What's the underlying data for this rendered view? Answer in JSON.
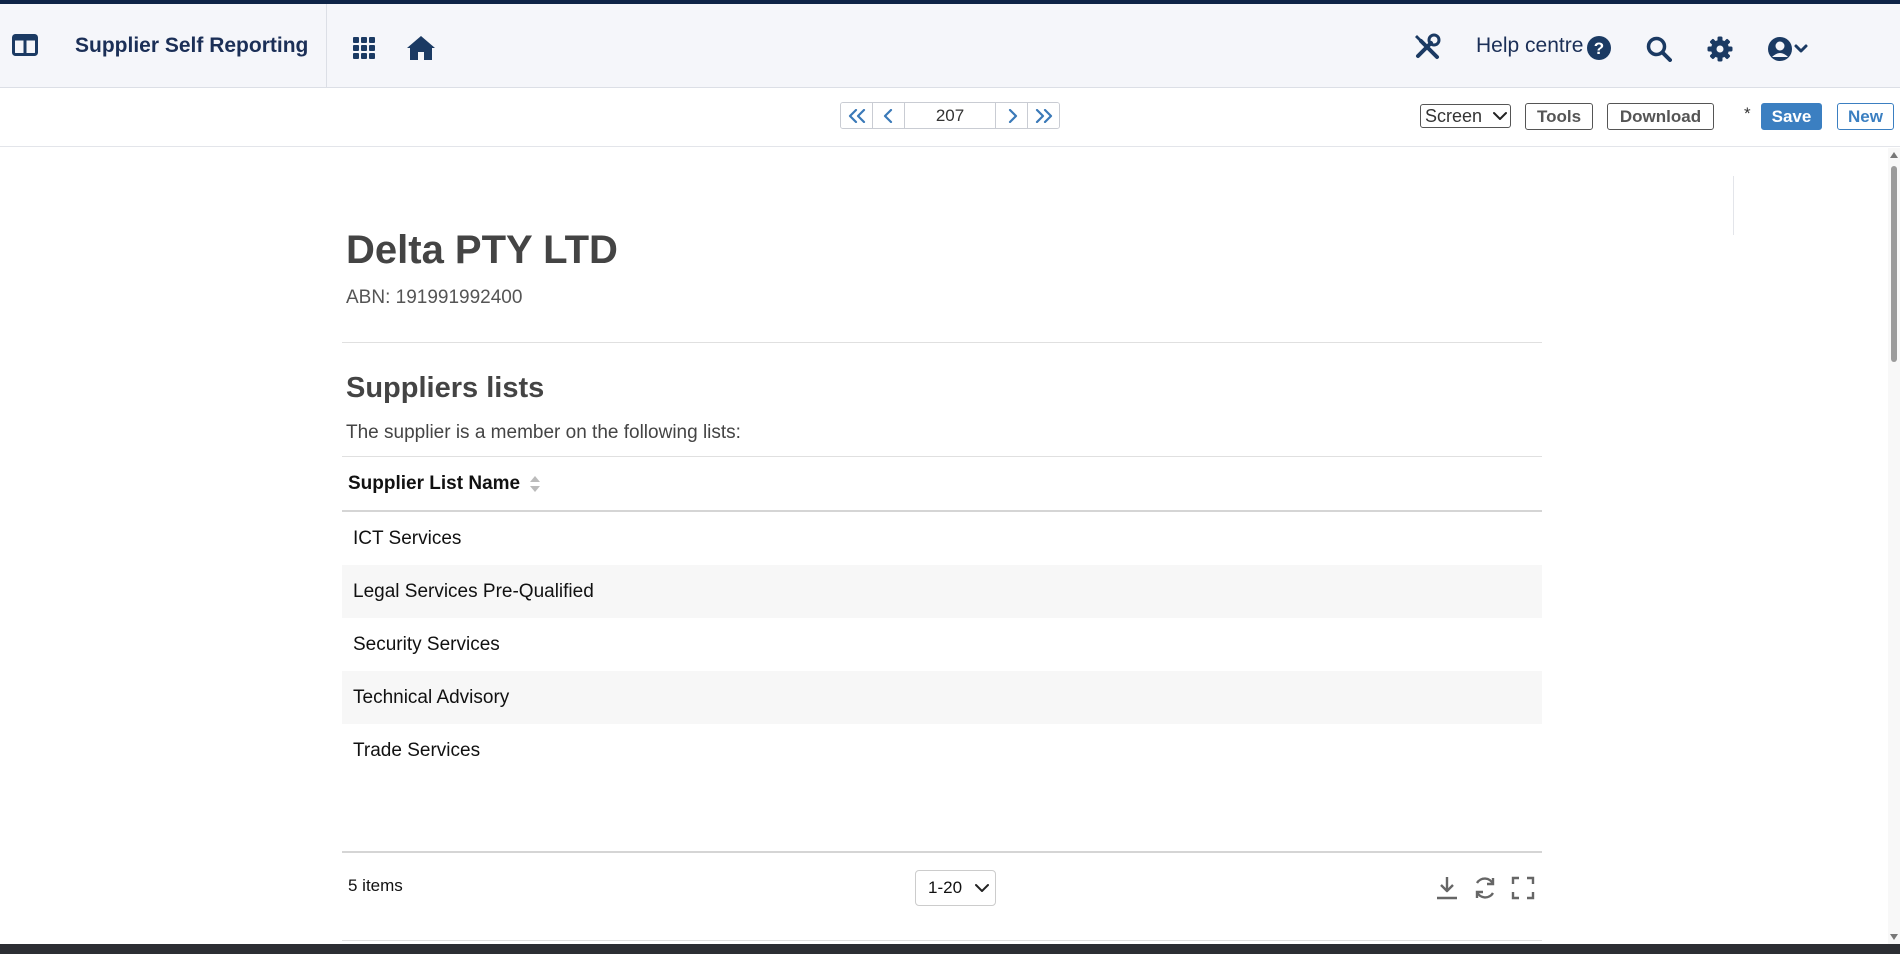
{
  "header": {
    "app_title": "Supplier Self Reporting",
    "help_label": "Help centre",
    "icons": [
      "panel-toggle-icon",
      "apps-grid-icon",
      "home-icon",
      "tools-icon",
      "help-circle-icon",
      "search-icon",
      "gear-icon",
      "user-account-icon"
    ]
  },
  "toolbar": {
    "record_number": "207",
    "view_mode": "Screen",
    "tools_label": "Tools",
    "download_label": "Download",
    "unsaved_marker": "*",
    "save_label": "Save",
    "new_label": "New"
  },
  "record": {
    "company_name": "Delta PTY LTD",
    "abn": "ABN: 191991992400"
  },
  "suppliers_section": {
    "title": "Suppliers lists",
    "description": "The supplier is a member on the following lists:",
    "table": {
      "columns": [
        "Supplier List Name"
      ],
      "rows": [
        "ICT Services",
        "Legal Services Pre-Qualified",
        "Security Services",
        "Technical Advisory",
        "Trade Services"
      ]
    },
    "footer": {
      "items_count": "5 items",
      "page_size": "1-20"
    }
  },
  "colors": {
    "brand_navy": "#0e2447",
    "accent_blue": "#3b7fc1",
    "header_bg": "#f5f6fa"
  }
}
